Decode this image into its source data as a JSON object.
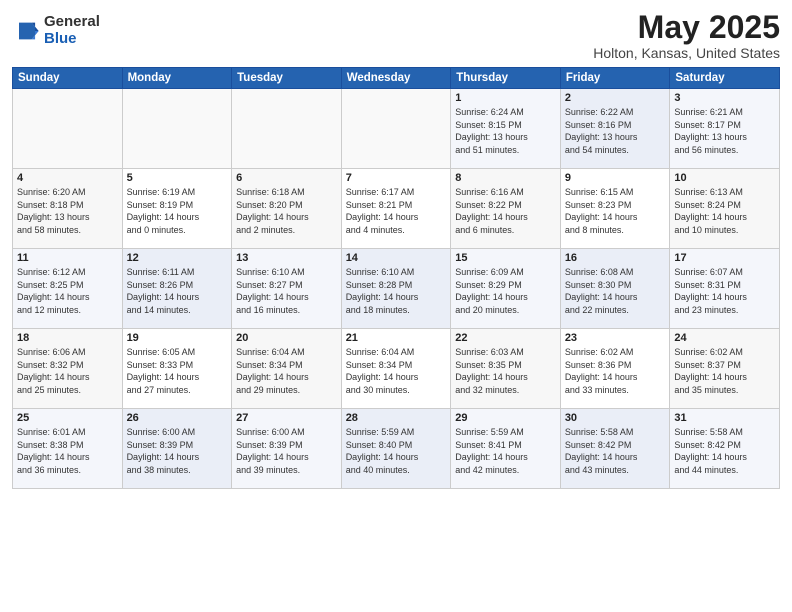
{
  "header": {
    "logo_general": "General",
    "logo_blue": "Blue",
    "title": "May 2025",
    "location": "Holton, Kansas, United States"
  },
  "columns": [
    "Sunday",
    "Monday",
    "Tuesday",
    "Wednesday",
    "Thursday",
    "Friday",
    "Saturday"
  ],
  "weeks": [
    [
      {
        "day": "",
        "info": ""
      },
      {
        "day": "",
        "info": ""
      },
      {
        "day": "",
        "info": ""
      },
      {
        "day": "",
        "info": ""
      },
      {
        "day": "1",
        "info": "Sunrise: 6:24 AM\nSunset: 8:15 PM\nDaylight: 13 hours\nand 51 minutes."
      },
      {
        "day": "2",
        "info": "Sunrise: 6:22 AM\nSunset: 8:16 PM\nDaylight: 13 hours\nand 54 minutes."
      },
      {
        "day": "3",
        "info": "Sunrise: 6:21 AM\nSunset: 8:17 PM\nDaylight: 13 hours\nand 56 minutes."
      }
    ],
    [
      {
        "day": "4",
        "info": "Sunrise: 6:20 AM\nSunset: 8:18 PM\nDaylight: 13 hours\nand 58 minutes."
      },
      {
        "day": "5",
        "info": "Sunrise: 6:19 AM\nSunset: 8:19 PM\nDaylight: 14 hours\nand 0 minutes."
      },
      {
        "day": "6",
        "info": "Sunrise: 6:18 AM\nSunset: 8:20 PM\nDaylight: 14 hours\nand 2 minutes."
      },
      {
        "day": "7",
        "info": "Sunrise: 6:17 AM\nSunset: 8:21 PM\nDaylight: 14 hours\nand 4 minutes."
      },
      {
        "day": "8",
        "info": "Sunrise: 6:16 AM\nSunset: 8:22 PM\nDaylight: 14 hours\nand 6 minutes."
      },
      {
        "day": "9",
        "info": "Sunrise: 6:15 AM\nSunset: 8:23 PM\nDaylight: 14 hours\nand 8 minutes."
      },
      {
        "day": "10",
        "info": "Sunrise: 6:13 AM\nSunset: 8:24 PM\nDaylight: 14 hours\nand 10 minutes."
      }
    ],
    [
      {
        "day": "11",
        "info": "Sunrise: 6:12 AM\nSunset: 8:25 PM\nDaylight: 14 hours\nand 12 minutes."
      },
      {
        "day": "12",
        "info": "Sunrise: 6:11 AM\nSunset: 8:26 PM\nDaylight: 14 hours\nand 14 minutes."
      },
      {
        "day": "13",
        "info": "Sunrise: 6:10 AM\nSunset: 8:27 PM\nDaylight: 14 hours\nand 16 minutes."
      },
      {
        "day": "14",
        "info": "Sunrise: 6:10 AM\nSunset: 8:28 PM\nDaylight: 14 hours\nand 18 minutes."
      },
      {
        "day": "15",
        "info": "Sunrise: 6:09 AM\nSunset: 8:29 PM\nDaylight: 14 hours\nand 20 minutes."
      },
      {
        "day": "16",
        "info": "Sunrise: 6:08 AM\nSunset: 8:30 PM\nDaylight: 14 hours\nand 22 minutes."
      },
      {
        "day": "17",
        "info": "Sunrise: 6:07 AM\nSunset: 8:31 PM\nDaylight: 14 hours\nand 23 minutes."
      }
    ],
    [
      {
        "day": "18",
        "info": "Sunrise: 6:06 AM\nSunset: 8:32 PM\nDaylight: 14 hours\nand 25 minutes."
      },
      {
        "day": "19",
        "info": "Sunrise: 6:05 AM\nSunset: 8:33 PM\nDaylight: 14 hours\nand 27 minutes."
      },
      {
        "day": "20",
        "info": "Sunrise: 6:04 AM\nSunset: 8:34 PM\nDaylight: 14 hours\nand 29 minutes."
      },
      {
        "day": "21",
        "info": "Sunrise: 6:04 AM\nSunset: 8:34 PM\nDaylight: 14 hours\nand 30 minutes."
      },
      {
        "day": "22",
        "info": "Sunrise: 6:03 AM\nSunset: 8:35 PM\nDaylight: 14 hours\nand 32 minutes."
      },
      {
        "day": "23",
        "info": "Sunrise: 6:02 AM\nSunset: 8:36 PM\nDaylight: 14 hours\nand 33 minutes."
      },
      {
        "day": "24",
        "info": "Sunrise: 6:02 AM\nSunset: 8:37 PM\nDaylight: 14 hours\nand 35 minutes."
      }
    ],
    [
      {
        "day": "25",
        "info": "Sunrise: 6:01 AM\nSunset: 8:38 PM\nDaylight: 14 hours\nand 36 minutes."
      },
      {
        "day": "26",
        "info": "Sunrise: 6:00 AM\nSunset: 8:39 PM\nDaylight: 14 hours\nand 38 minutes."
      },
      {
        "day": "27",
        "info": "Sunrise: 6:00 AM\nSunset: 8:39 PM\nDaylight: 14 hours\nand 39 minutes."
      },
      {
        "day": "28",
        "info": "Sunrise: 5:59 AM\nSunset: 8:40 PM\nDaylight: 14 hours\nand 40 minutes."
      },
      {
        "day": "29",
        "info": "Sunrise: 5:59 AM\nSunset: 8:41 PM\nDaylight: 14 hours\nand 42 minutes."
      },
      {
        "day": "30",
        "info": "Sunrise: 5:58 AM\nSunset: 8:42 PM\nDaylight: 14 hours\nand 43 minutes."
      },
      {
        "day": "31",
        "info": "Sunrise: 5:58 AM\nSunset: 8:42 PM\nDaylight: 14 hours\nand 44 minutes."
      }
    ]
  ]
}
